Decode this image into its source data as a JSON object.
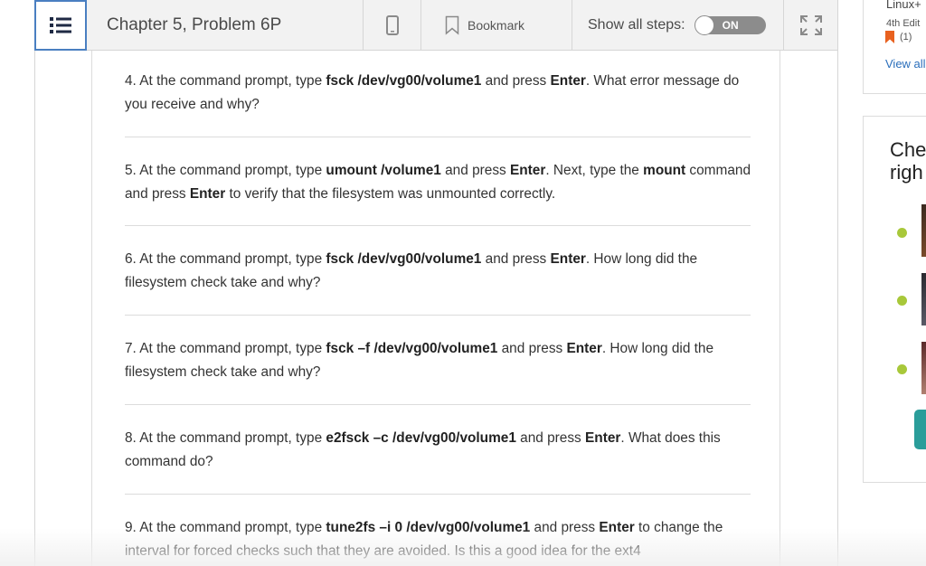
{
  "toolbar": {
    "chapter_title": "Chapter 5, Problem 6P",
    "bookmark_label": "Bookmark",
    "show_steps_label": "Show all steps:",
    "toggle_state": "ON"
  },
  "steps": [
    {
      "pre": "4. At the command prompt, type ",
      "b1": "fsck /dev/vg00/volume1",
      "mid1": " and press ",
      "b2": "Enter",
      "mid2": ". What error message do you receive and why?",
      "b3": "",
      "post": ""
    },
    {
      "pre": "5. At the command prompt, type ",
      "b1": "umount /volume1",
      "mid1": " and press ",
      "b2": "Enter",
      "mid2": ". Next, type the ",
      "b3": "mount",
      "post": " command and press ",
      "b4": "Enter",
      "post2": " to verify that the filesystem was unmounted correctly."
    },
    {
      "pre": "6. At the command prompt, type ",
      "b1": "fsck /dev/vg00/volume1",
      "mid1": " and press ",
      "b2": "Enter",
      "mid2": ". How long did the filesystem check take and why?",
      "b3": "",
      "post": ""
    },
    {
      "pre": "7. At the command prompt, type ",
      "b1": "fsck –f /dev/vg00/volume1",
      "mid1": " and press ",
      "b2": "Enter",
      "mid2": ". How long did the filesystem check take and why?",
      "b3": "",
      "post": ""
    },
    {
      "pre": "8. At the command prompt, type ",
      "b1": "e2fsck –c /dev/vg00/volume1",
      "mid1": " and press ",
      "b2": "Enter",
      "mid2": ". What does this command do?",
      "b3": "",
      "post": ""
    },
    {
      "pre": "9. At the command prompt, type ",
      "b1": "tune2fs –i 0 /dev/vg00/volume1",
      "mid1": " and press ",
      "b2": "Enter",
      "mid2": " to change the interval for forced checks such that they are avoided. Is this a good idea for the ext4",
      "b3": "",
      "post": ""
    }
  ],
  "right_panel": {
    "book_title": "Linux+",
    "edition": "4th Edit",
    "bookmark_count": "(1)",
    "view_all": "View all",
    "heading": "Che\nrigh"
  },
  "colors": {
    "accent_blue": "#4a7fc1",
    "link_blue": "#2a6ebb",
    "bookmark_orange": "#e8611f",
    "dot_green": "#a8c83a",
    "teal": "#2a9d9a"
  }
}
